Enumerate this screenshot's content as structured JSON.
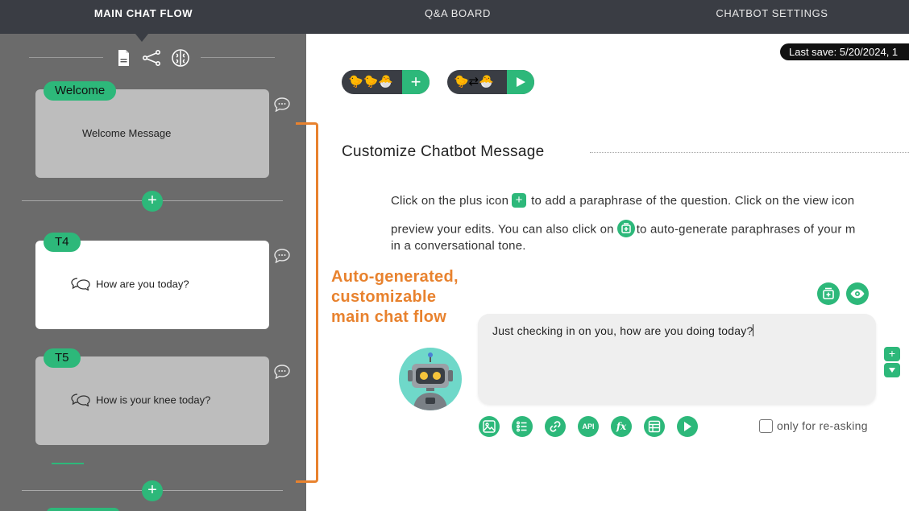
{
  "nav": {
    "tabs": [
      {
        "label": "MAIN CHAT FLOW",
        "active": true
      },
      {
        "label": "Q&A BOARD",
        "active": false
      },
      {
        "label": "CHATBOT SETTINGS",
        "active": false
      }
    ]
  },
  "sidebar": {
    "tools": [
      "document-icon",
      "flow-share-icon",
      "brain-icon"
    ],
    "nodes": [
      {
        "tag": "Welcome",
        "text": "Welcome Message",
        "active": false
      },
      {
        "tag": "T4",
        "text": "How are you today?",
        "active": true
      },
      {
        "tag": "T5",
        "text": "How is your knee today?",
        "active": false
      }
    ],
    "add_label": "+"
  },
  "annotation": {
    "lines": [
      "Auto-generated,",
      "customizable",
      "main chat flow"
    ],
    "color": "#e8822e"
  },
  "main": {
    "last_save": "Last save: 5/20/2024, 1",
    "pill1_ducks": "🐤🐤🐣",
    "pill2_ducks": "🐤⇄🐣",
    "section_title": "Customize Chatbot Message",
    "instructions": {
      "line1_a": "Click on the plus icon",
      "line1_b": "to add a paraphrase of the question. Click on the view icon",
      "line2_a": "preview your edits. You can also click on",
      "line2_b": "to auto-generate paraphrases of your m",
      "line3": "in a conversational tone."
    },
    "message": "Just checking in on you, how are you doing today?",
    "toolbar": [
      "image-icon",
      "list-icon",
      "link-icon",
      "API",
      "fx",
      "table-icon",
      "send-icon"
    ],
    "api_label": "API",
    "fx_label": "fx",
    "reask_label": "only for re-asking",
    "reask_checked": false
  },
  "colors": {
    "accent": "#2db87a",
    "nav_bg": "#3a3d44",
    "sidebar_bg": "#6b6b6b",
    "annotation": "#e8822e"
  }
}
